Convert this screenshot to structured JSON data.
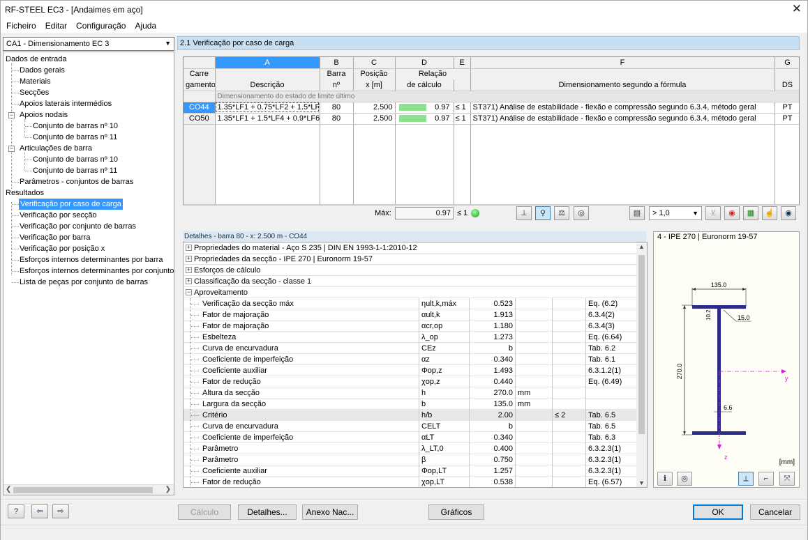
{
  "window": {
    "title": "RF-STEEL EC3 - [Andaimes em aço]"
  },
  "menu": [
    "Ficheiro",
    "Editar",
    "Configuração",
    "Ajuda"
  ],
  "left": {
    "case_selector": "CA1 - Dimensionamento EC 3",
    "tree": {
      "input_root": "Dados de entrada",
      "input_items": [
        "Dados gerais",
        "Materiais",
        "Secções",
        "Apoios laterais intermédios"
      ],
      "nodal_supports": "Apoios nodais",
      "nodal_children": [
        "Conjunto de barras nº 10",
        "Conjunto de barras nº 11"
      ],
      "hinges": "Articulações de barra",
      "hinge_children": [
        "Conjunto de barras nº 10",
        "Conjunto de barras nº 11"
      ],
      "params": "Parâmetros - conjuntos de barras",
      "results_root": "Resultados",
      "result_items": [
        "Verificação por caso de carga",
        "Verificação por secção",
        "Verificação por conjunto de barras",
        "Verificação por barra",
        "Verificação por posição x",
        "Esforços internos determinantes por barra",
        "Esforços internos determinantes por conjunto",
        "Lista de peças por conjunto de barras"
      ]
    }
  },
  "main": {
    "header": "2.1 Verificação por caso de carga",
    "columns_letters": [
      "A",
      "B",
      "C",
      "D",
      "E",
      "F",
      "G"
    ],
    "col_header": {
      "carre": "Carre",
      "gamento": "gamento",
      "descricao": "Descrição",
      "barra": "Barra",
      "barra_n": "nº",
      "posicao": "Posição",
      "posicao_x": "x [m]",
      "relacao": "Relação",
      "relacao_calc": "de cálculo",
      "formula": "Dimensionamento segundo a fórmula",
      "ds": "DS"
    },
    "group_label": "Dimensionamento do estado de limite último",
    "rows": [
      {
        "id": "CO44",
        "desc": "1.35*LF1 + 0.75*LF2 + 1.5*LF",
        "barra": "80",
        "pos": "2.500",
        "ratio": "0.97",
        "ratio_value": 0.97,
        "cmp": "≤ 1",
        "formula": "ST371) Análise de estabilidade - flexão e compressão segundo 6.3.4, método geral",
        "ds": "PT"
      },
      {
        "id": "CO50",
        "desc": "1.35*LF1 + 1.5*LF4 + 0.9*LF6",
        "barra": "80",
        "pos": "2.500",
        "ratio": "0.97",
        "ratio_value": 0.97,
        "cmp": "≤ 1",
        "formula": "ST371) Análise de estabilidade - flexão e compressão segundo 6.3.4, método geral",
        "ds": "PT"
      }
    ],
    "max_label": "Máx:",
    "max_value": "0.97",
    "max_cmp": "≤ 1",
    "filter_select": "> 1,0"
  },
  "details": {
    "header": "Detalhes - barra 80 - x: 2.500 m - CO44",
    "groups": [
      "Propriedades do material - Aço S 235 | DIN EN 1993-1-1:2010-12",
      "Propriedades da secção -  IPE 270 | Euronorm 19-57",
      "Esforços de cálculo",
      "Classificação da secção - classe 1",
      "Aproveitamento"
    ],
    "rows": [
      {
        "name": "Verificação da secção máx",
        "sym": "ηult,k,máx",
        "val": "0.523",
        "unit": "",
        "cmp": "",
        "ref": "Eq. (6.2)"
      },
      {
        "name": "Fator de majoração",
        "sym": "αult,k",
        "val": "1.913",
        "unit": "",
        "cmp": "",
        "ref": "6.3.4(2)"
      },
      {
        "name": "Fator de majoração",
        "sym": "αcr,op",
        "val": "1.180",
        "unit": "",
        "cmp": "",
        "ref": "6.3.4(3)"
      },
      {
        "name": "Esbelteza",
        "sym": "λ_op",
        "val": "1.273",
        "unit": "",
        "cmp": "",
        "ref": "Eq. (6.64)"
      },
      {
        "name": "Curva de encurvadura",
        "sym": "CEz",
        "val": "b",
        "unit": "",
        "cmp": "",
        "ref": "Tab. 6.2"
      },
      {
        "name": "Coeficiente de imperfeição",
        "sym": "αz",
        "val": "0.340",
        "unit": "",
        "cmp": "",
        "ref": "Tab. 6.1"
      },
      {
        "name": "Coeficiente auxiliar",
        "sym": "Φop,z",
        "val": "1.493",
        "unit": "",
        "cmp": "",
        "ref": "6.3.1.2(1)"
      },
      {
        "name": "Fator de redução",
        "sym": "χop,z",
        "val": "0.440",
        "unit": "",
        "cmp": "",
        "ref": "Eq. (6.49)"
      },
      {
        "name": "Altura da secção",
        "sym": "h",
        "val": "270.0",
        "unit": "mm",
        "cmp": "",
        "ref": ""
      },
      {
        "name": "Largura da secção",
        "sym": "b",
        "val": "135.0",
        "unit": "mm",
        "cmp": "",
        "ref": ""
      },
      {
        "name": "Critério",
        "sym": "h/b",
        "val": "2.00",
        "unit": "",
        "cmp": "≤ 2",
        "ref": "Tab. 6.5"
      },
      {
        "name": "Curva de encurvadura",
        "sym": "CELT",
        "val": "b",
        "unit": "",
        "cmp": "",
        "ref": "Tab. 6.5"
      },
      {
        "name": "Coeficiente de imperfeição",
        "sym": "αLT",
        "val": "0.340",
        "unit": "",
        "cmp": "",
        "ref": "Tab. 6.3"
      },
      {
        "name": "Parâmetro",
        "sym": "λ_LT,0",
        "val": "0.400",
        "unit": "",
        "cmp": "",
        "ref": "6.3.2.3(1)"
      },
      {
        "name": "Parâmetro",
        "sym": "β",
        "val": "0.750",
        "unit": "",
        "cmp": "",
        "ref": "6.3.2.3(1)"
      },
      {
        "name": "Coeficiente auxiliar",
        "sym": "Φop,LT",
        "val": "1.257",
        "unit": "",
        "cmp": "",
        "ref": "6.3.2.3(1)"
      },
      {
        "name": "Fator de redução",
        "sym": "χop,LT",
        "val": "0.538",
        "unit": "",
        "cmp": "",
        "ref": "Eq. (6.57)"
      }
    ]
  },
  "section": {
    "title": "4 - IPE 270 | Euronorm 19-57",
    "dim_b": "135.0",
    "dim_h": "270.0",
    "dim_tf": "10.2",
    "dim_r": "15.0",
    "dim_tw": "6.6",
    "axis_y": "y",
    "axis_z": "z",
    "unit": "[mm]"
  },
  "buttons": {
    "calc": "Cálculo",
    "details": "Detalhes...",
    "annex": "Anexo Nac...",
    "graphics": "Gráficos",
    "ok": "OK",
    "cancel": "Cancelar"
  }
}
